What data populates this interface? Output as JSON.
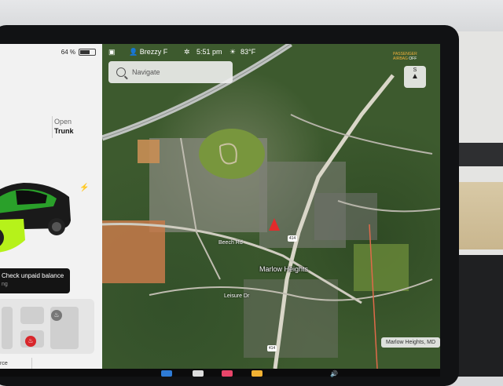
{
  "car_panel": {
    "battery_percent": "64 %",
    "battery_level": 0.64,
    "trunk_title": "Open",
    "trunk_label": "Trunk",
    "charge_icon": "lightning-icon",
    "alert_title": "Check unpaid balance",
    "alert_sub": "ng",
    "bottom_text": "rce"
  },
  "statusbar": {
    "profile_name": "Brezzy F",
    "time": "5:51 pm",
    "temperature": "83°F",
    "passenger_airbag_line1": "PASSENGER",
    "passenger_airbag_line2": "AIRBAG",
    "passenger_airbag_state": "OFF"
  },
  "search": {
    "placeholder": "Navigate"
  },
  "compass": {
    "label": "S"
  },
  "map": {
    "city_label": "Marlow Heights",
    "road_label_1": "Beech Rd",
    "road_label_2": "Leisure Dr",
    "route_1": "414",
    "route_2": "414",
    "location_chip": "Marlow Heights, MD"
  },
  "colors": {
    "nav_arrow": "#e32b2b",
    "alert_bg": "#141414",
    "seat_heater": "#d8262b"
  }
}
